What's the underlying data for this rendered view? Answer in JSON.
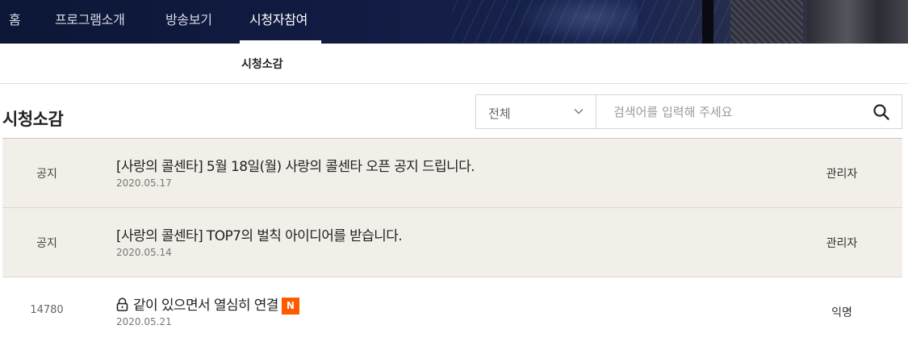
{
  "topnav": {
    "items": [
      "홈",
      "프로그램소개",
      "방송보기",
      "시청자참여"
    ],
    "active_index": 3
  },
  "subnav": {
    "active_tab": "시청소감"
  },
  "page": {
    "title": "시청소감"
  },
  "search": {
    "filter_value": "전체",
    "placeholder": "검색어를 입력해 주세요",
    "button_icon": "search-icon"
  },
  "posts": [
    {
      "num": "공지",
      "title": "[사랑의 콜센타] 5월 18일(월) 사랑의 콜센타 오픈 공지 드립니다.",
      "date": "2020.05.17",
      "author": "관리자",
      "locked": false,
      "is_new": false,
      "notice": true
    },
    {
      "num": "공지",
      "title": "[사랑의 콜센타] TOP7의 벌칙 아이디어를 받습니다.",
      "date": "2020.05.14",
      "author": "관리자",
      "locked": false,
      "is_new": false,
      "notice": true
    },
    {
      "num": "14780",
      "title": "같이 있으면서 열심히 연결",
      "date": "2020.05.21",
      "author": "익명",
      "locked": true,
      "is_new": true,
      "new_label": "N",
      "notice": false
    }
  ],
  "colors": {
    "nav_bg": "#131d45",
    "notice_row_bg": "#f2efe9",
    "new_badge": "#ff5a00"
  }
}
